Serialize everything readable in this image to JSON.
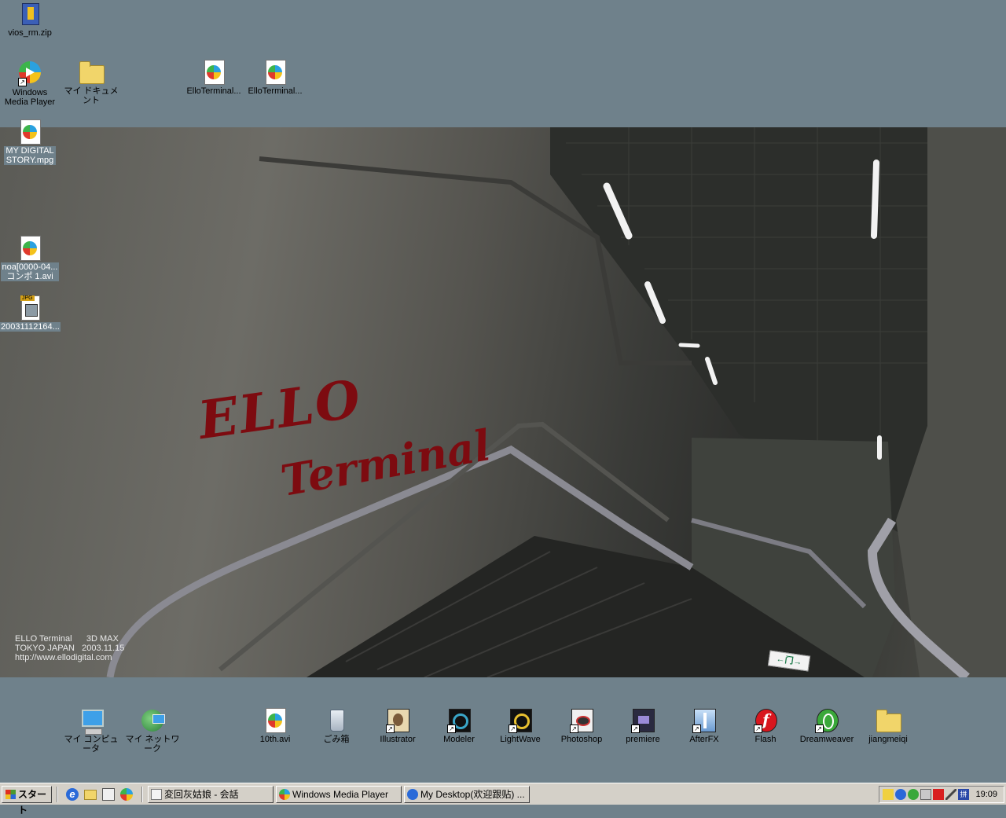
{
  "desktop": {
    "top_icons": [
      {
        "label": "vios_rm.zip",
        "icon": "zip-archive-icon"
      },
      {
        "label": "Windows Media Player",
        "icon": "windows-media-player-icon"
      },
      {
        "label": "マイ ドキュメント",
        "icon": "my-documents-folder-icon"
      },
      {
        "label": "ElloTerminal...",
        "icon": "media-file-icon"
      },
      {
        "label": "ElloTerminal...",
        "icon": "media-file-icon"
      },
      {
        "label": "MY DIGITAL STORY.mpg",
        "icon": "media-file-icon"
      },
      {
        "label": "noa[0000-04... コンポ 1.avi",
        "icon": "media-file-icon"
      },
      {
        "label": "20031112164...",
        "icon": "jpg-file-icon"
      }
    ],
    "bottom_icons": [
      {
        "label": "マイ コンピュータ",
        "icon": "my-computer-icon"
      },
      {
        "label": "マイ ネットワーク",
        "icon": "my-network-icon"
      },
      {
        "label": "10th.avi",
        "icon": "media-file-icon"
      },
      {
        "label": "ごみ箱",
        "icon": "recycle-bin-icon"
      },
      {
        "label": "Illustrator",
        "icon": "illustrator-icon"
      },
      {
        "label": "Modeler",
        "icon": "modeler-icon"
      },
      {
        "label": "LightWave",
        "icon": "lightwave-icon"
      },
      {
        "label": "Photoshop",
        "icon": "photoshop-icon"
      },
      {
        "label": "premiere",
        "icon": "premiere-icon"
      },
      {
        "label": "AfterFX",
        "icon": "afterfx-icon"
      },
      {
        "label": "Flash",
        "icon": "flash-icon"
      },
      {
        "label": "Dreamweaver",
        "icon": "dreamweaver-icon"
      },
      {
        "label": "jiangmeiqi",
        "icon": "folder-icon"
      }
    ]
  },
  "wallpaper": {
    "logo_line1": "ELLO",
    "logo_line2": "Terminal",
    "exit_sign": "←门→",
    "credit": {
      "line1": "ELLO Terminal      3D MAX",
      "line2": "TOKYO JAPAN   2003.11.15",
      "line3": "http://www.ellodigital.com"
    }
  },
  "taskbar": {
    "start_label": "スタート",
    "tasks": [
      {
        "label": "変回灰姑娘 - 会話",
        "icon": "chat-window-icon"
      },
      {
        "label": "Windows Media Player",
        "icon": "windows-media-player-icon"
      },
      {
        "label": "My Desktop(欢迎跟贴) ...",
        "icon": "internet-explorer-icon"
      }
    ],
    "clock": "19:09"
  }
}
